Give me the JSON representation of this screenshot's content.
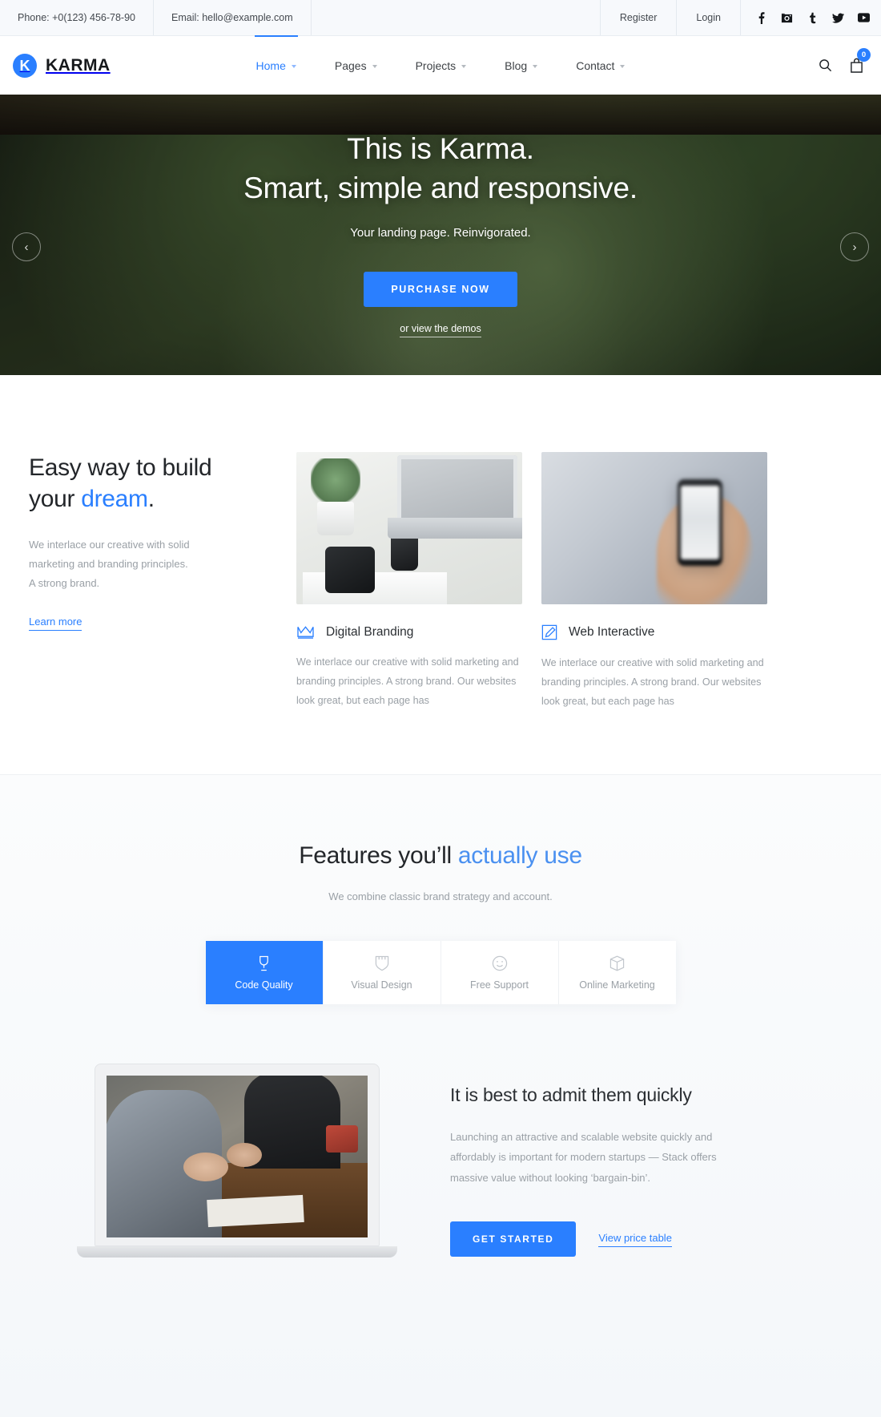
{
  "topbar": {
    "phone": "Phone: +0(123) 456-78-90",
    "email": "Email: hello@example.com",
    "register": "Register",
    "login": "Login",
    "social": [
      {
        "name": "facebook-icon",
        "label": "Facebook"
      },
      {
        "name": "instagram-icon",
        "label": "Instagram"
      },
      {
        "name": "tumblr-icon",
        "label": "Tumblr"
      },
      {
        "name": "twitter-icon",
        "label": "Twitter"
      },
      {
        "name": "youtube-icon",
        "label": "YouTube"
      }
    ]
  },
  "nav": {
    "logo_letter": "K",
    "brand": "KARMA",
    "menu": [
      {
        "label": "Home",
        "active": true
      },
      {
        "label": "Pages",
        "active": false
      },
      {
        "label": "Projects",
        "active": false
      },
      {
        "label": "Blog",
        "active": false
      },
      {
        "label": "Contact",
        "active": false
      }
    ],
    "search_icon": "search-icon",
    "cart_icon": "cart-icon",
    "cart_count": "0"
  },
  "hero": {
    "title_line1": "This is Karma.",
    "title_line2": "Smart, simple and responsive.",
    "subtitle": "Your landing page. Reinvigorated.",
    "cta": "PURCHASE NOW",
    "demos_link": "or view the demos",
    "prev": "‹",
    "next": "›",
    "accent": "#2a7fff"
  },
  "build": {
    "heading_a": "Easy way to build",
    "heading_b": "your ",
    "heading_accent": "dream",
    "heading_c": ".",
    "paragraph": "We interlace our creative with solid marketing and branding principles. A strong brand.",
    "link": "Learn more",
    "cards": [
      {
        "icon": "crown-icon",
        "title": "Digital Branding",
        "text": "We interlace our creative with solid marketing and branding principles. A strong brand. Our websites look great, but each page has"
      },
      {
        "icon": "pencil-edit-icon",
        "title": "Web Interactive",
        "text": "We interlace our creative with solid marketing and branding principles. A strong brand. Our websites look great, but each page has"
      }
    ]
  },
  "features": {
    "heading_a": "Features you’ll ",
    "heading_accent": "actually use",
    "subtitle": "We combine classic brand strategy and account.",
    "tabs": [
      {
        "label": "Code Quality",
        "icon": "trophy-icon",
        "active": true
      },
      {
        "label": "Visual Design",
        "icon": "shield-icon",
        "active": false
      },
      {
        "label": "Free Support",
        "icon": "smiley-icon",
        "active": false
      },
      {
        "label": "Online Marketing",
        "icon": "box-icon",
        "active": false
      }
    ],
    "panel": {
      "title": "It is best to admit them quickly",
      "text": "Launching an attractive and scalable website quickly and affordably is important for modern startups — Stack offers massive value without looking ‘bargain-bin’.",
      "primary_cta": "GET STARTED",
      "secondary_link": "View price table"
    }
  }
}
